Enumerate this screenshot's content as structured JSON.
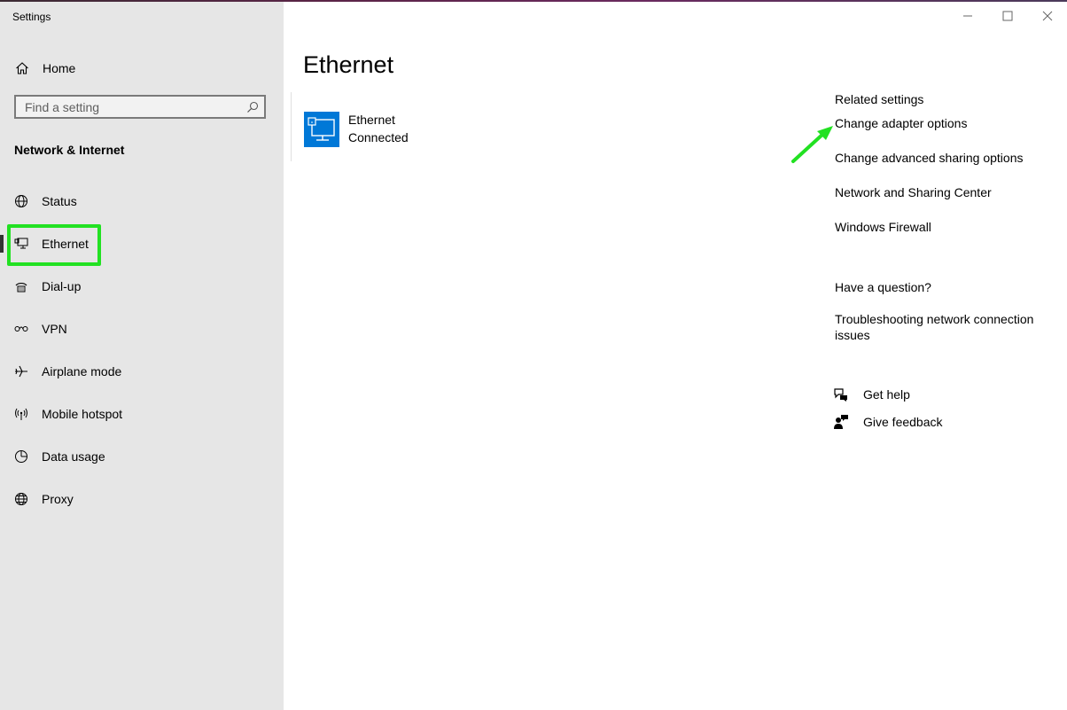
{
  "window": {
    "app_title": "Settings"
  },
  "sidebar": {
    "home_label": "Home",
    "search_placeholder": "Find a setting",
    "section_heading": "Network & Internet",
    "items": [
      {
        "label": "Status",
        "icon": "globe-status-icon"
      },
      {
        "label": "Ethernet",
        "icon": "ethernet-icon",
        "selected": true
      },
      {
        "label": "Dial-up",
        "icon": "dialup-icon"
      },
      {
        "label": "VPN",
        "icon": "vpn-icon"
      },
      {
        "label": "Airplane mode",
        "icon": "airplane-icon"
      },
      {
        "label": "Mobile hotspot",
        "icon": "hotspot-icon"
      },
      {
        "label": "Data usage",
        "icon": "data-usage-icon"
      },
      {
        "label": "Proxy",
        "icon": "globe-icon"
      }
    ]
  },
  "main": {
    "title": "Ethernet",
    "connection": {
      "name": "Ethernet",
      "status": "Connected"
    }
  },
  "related": {
    "title": "Related settings",
    "links": [
      "Change adapter options",
      "Change advanced sharing options",
      "Network and Sharing Center",
      "Windows Firewall"
    ]
  },
  "question": {
    "title": "Have a question?",
    "link": "Troubleshooting network connection issues"
  },
  "help": {
    "get_help": "Get help",
    "give_feedback": "Give feedback"
  },
  "colors": {
    "sidebar_bg": "#e6e6e6",
    "accent": "#0078d7",
    "annotation_green": "#22e122"
  }
}
